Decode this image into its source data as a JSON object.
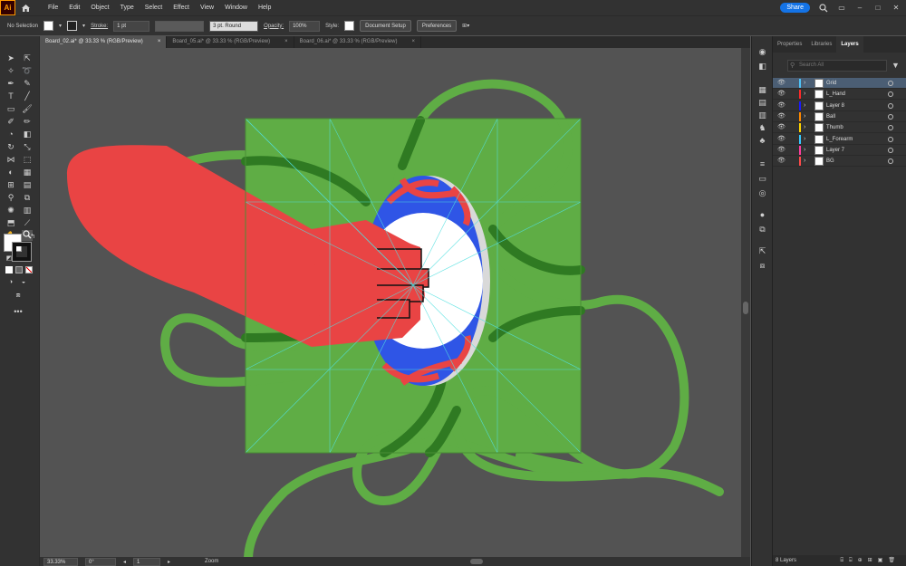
{
  "app": {
    "logo": "Ai"
  },
  "menu": [
    "File",
    "Edit",
    "Object",
    "Type",
    "Select",
    "Effect",
    "View",
    "Window",
    "Help"
  ],
  "share_label": "Share",
  "control": {
    "selection": "No Selection",
    "stroke_label": "Stroke:",
    "stroke_value": "1 pt",
    "brush": "3 pt. Round",
    "opacity_label": "Opacity:",
    "opacity_value": "100%",
    "style_label": "Style:",
    "doc_setup": "Document Setup",
    "preferences": "Preferences"
  },
  "tabs": [
    {
      "label": "Board_02.ai* @ 33.33 % (RGB/Preview)",
      "close": "×"
    },
    {
      "label": "Board_05.ai* @ 33.33 % (RGB/Preview)",
      "close": "×"
    },
    {
      "label": "Board_06.ai* @ 33.33 % (RGB/Preview)",
      "close": "×"
    }
  ],
  "panel": {
    "tabs": [
      "Properties",
      "Libraries",
      "Layers"
    ],
    "search_placeholder": "Search All",
    "layers": [
      {
        "name": "Grid",
        "color": "#4fc3f7"
      },
      {
        "name": "L_Hand",
        "color": "#ff2a2a"
      },
      {
        "name": "Layer 8",
        "color": "#1a1aff"
      },
      {
        "name": "Ball",
        "color": "#ff8a00"
      },
      {
        "name": "Thumb",
        "color": "#ffd400"
      },
      {
        "name": "L_Forearm",
        "color": "#37c8ff"
      },
      {
        "name": "Layer 7",
        "color": "#ff3ea0"
      },
      {
        "name": "BG",
        "color": "#ff4a4a"
      }
    ],
    "footer": "8 Layers"
  },
  "status": {
    "zoom": "33.33%",
    "angle": "0°",
    "artboard": "1",
    "mode": "Zoom"
  },
  "colors": {
    "bg_green": "#5fad45",
    "cord_green": "#5fad45",
    "cord_dark": "#2f7a22",
    "hand_red": "#e94444",
    "ball_blue": "#2f55e6",
    "ball_red": "#e94444",
    "guide": "#52e0e0"
  }
}
